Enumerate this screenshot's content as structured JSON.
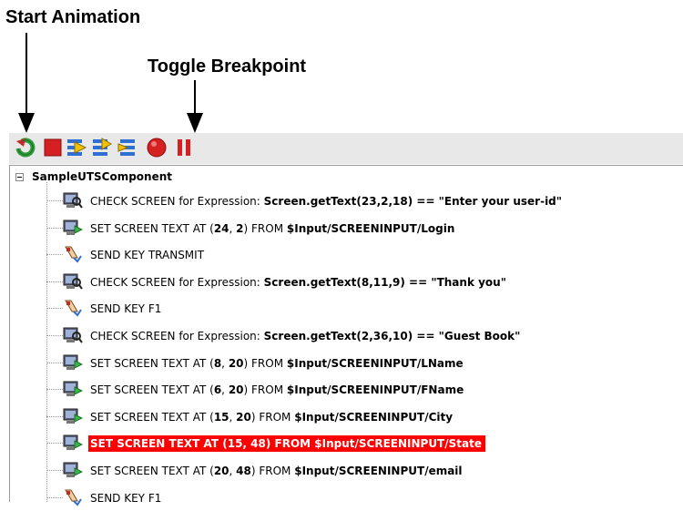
{
  "callouts": {
    "start_animation": "Start Animation",
    "toggle_breakpoint": "Toggle Breakpoint"
  },
  "toolbar": {
    "buttons": [
      {
        "name": "start-animation",
        "icon": "green-circular-arrow-icon",
        "color": "#2e9b3a"
      },
      {
        "name": "stop",
        "icon": "red-square-stop-icon",
        "color": "#d42020"
      },
      {
        "name": "step-into",
        "icon": "blue-step-icon",
        "color": "#2f6fd1"
      },
      {
        "name": "step-over",
        "icon": "blue-step-icon",
        "color": "#2f6fd1"
      },
      {
        "name": "step-out",
        "icon": "blue-step-icon",
        "color": "#2f6fd1"
      },
      {
        "name": "toggle-breakpoint",
        "icon": "red-circle-breakpoint-icon",
        "color": "#d42020"
      },
      {
        "name": "pause",
        "icon": "red-pause-icon",
        "color": "#d42020"
      }
    ]
  },
  "tree": {
    "root_label": "SampleUTSComponent",
    "selected_color": "#ff0000",
    "items": [
      {
        "icon": "screen-check-icon",
        "prefix": "CHECK SCREEN for Expression: ",
        "parts": [
          {
            "t": "Screen.getText(23,2,18) == \"Enter your user-id\"",
            "b": true
          }
        ]
      },
      {
        "icon": "screen-set-text-icon",
        "prefix": "SET SCREEN TEXT AT (",
        "parts": [
          {
            "t": "24",
            "b": true
          },
          {
            "t": ", ",
            "b": false
          },
          {
            "t": "2",
            "b": true
          },
          {
            "t": ") FROM ",
            "b": false
          },
          {
            "t": "$Input/SCREENINPUT/Login",
            "b": true
          }
        ]
      },
      {
        "icon": "send-key-icon",
        "prefix": "SEND KEY TRANSMIT",
        "parts": []
      },
      {
        "icon": "screen-check-icon",
        "prefix": "CHECK SCREEN for Expression: ",
        "parts": [
          {
            "t": "Screen.getText(8,11,9) == \"Thank you\"",
            "b": true
          }
        ]
      },
      {
        "icon": "send-key-icon",
        "prefix": "SEND KEY F1",
        "parts": []
      },
      {
        "icon": "screen-check-icon",
        "prefix": "CHECK SCREEN for Expression: ",
        "parts": [
          {
            "t": "Screen.getText(2,36,10) == \"Guest Book\"",
            "b": true
          }
        ]
      },
      {
        "icon": "screen-set-text-icon",
        "prefix": "SET SCREEN TEXT AT (",
        "parts": [
          {
            "t": "8",
            "b": true
          },
          {
            "t": ", ",
            "b": false
          },
          {
            "t": "20",
            "b": true
          },
          {
            "t": ") FROM ",
            "b": false
          },
          {
            "t": "$Input/SCREENINPUT/LName",
            "b": true
          }
        ]
      },
      {
        "icon": "screen-set-text-icon",
        "prefix": "SET SCREEN TEXT AT (",
        "parts": [
          {
            "t": "6",
            "b": true
          },
          {
            "t": ", ",
            "b": false
          },
          {
            "t": "20",
            "b": true
          },
          {
            "t": ") FROM ",
            "b": false
          },
          {
            "t": "$Input/SCREENINPUT/FName",
            "b": true
          }
        ]
      },
      {
        "icon": "screen-set-text-icon",
        "prefix": "SET SCREEN TEXT AT (",
        "parts": [
          {
            "t": "15",
            "b": true
          },
          {
            "t": ", ",
            "b": false
          },
          {
            "t": "20",
            "b": true
          },
          {
            "t": ") FROM ",
            "b": false
          },
          {
            "t": "$Input/SCREENINPUT/City",
            "b": true
          }
        ]
      },
      {
        "icon": "screen-set-text-icon",
        "selected": true,
        "prefix": "SET SCREEN TEXT AT (",
        "parts": [
          {
            "t": "15, 48) FROM $Input/SCREENINPUT/State",
            "b": true
          }
        ]
      },
      {
        "icon": "screen-set-text-icon",
        "prefix": "SET SCREEN TEXT AT (",
        "parts": [
          {
            "t": "20",
            "b": true
          },
          {
            "t": ", ",
            "b": false
          },
          {
            "t": "48",
            "b": true
          },
          {
            "t": ") FROM ",
            "b": false
          },
          {
            "t": "$Input/SCREENINPUT/email",
            "b": true
          }
        ]
      },
      {
        "icon": "send-key-icon",
        "prefix": "SEND KEY F1",
        "parts": []
      }
    ]
  }
}
